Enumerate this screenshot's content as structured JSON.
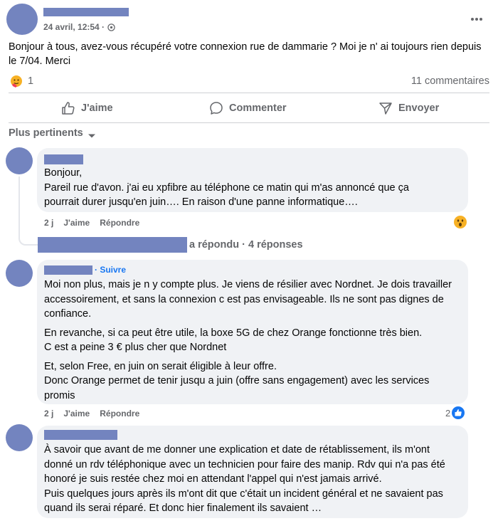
{
  "post": {
    "date": "24 avril, 12:54 ·",
    "text": "Bonjour à tous, avez-vous récupéré votre connexion rue de dammarie ? Moi je n' ai toujours rien depuis le 7/04. Merci",
    "reaction_count": "1",
    "comments_count": "11 commentaires",
    "options_icon": "more-horizontal-icon",
    "audience_icon": "globe-icon"
  },
  "actions": {
    "like": "J'aime",
    "comment": "Commenter",
    "send": "Envoyer"
  },
  "sort": {
    "label": "Plus pertinents"
  },
  "comments": [
    {
      "lines": [
        "Bonjour,",
        "Pareil rue d'avon. j'ai eu xpfibre au téléphone ce matin qui m'as annoncé que ça pourrait durer jusqu'en juin…. En raison d'une panne informatique…."
      ],
      "time": "2 j",
      "like": "J'aime",
      "reply": "Répondre",
      "reaction": "wow"
    },
    {
      "follow": "· Suivre",
      "paragraphs": [
        "Moi non plus, mais je n y compte plus. Je viens de résilier avec Nordnet. Je dois travailler accessoirement, et sans la connexion c est pas envisageable. Ils ne sont pas dignes de confiance.",
        "En revanche, si ca peut être utile, la boxe 5G de chez Orange fonctionne très bien.\nC est a peine 3 € plus cher que Nordnet",
        "Et, selon Free, en juin on serait éligible à leur offre.\nDonc Orange permet de tenir jusqu a juin (offre sans engagement) avec les services promis"
      ],
      "time": "2 j",
      "like": "J'aime",
      "reply": "Répondre",
      "reaction_count": "2"
    },
    {
      "text": "À savoir que avant de me donner une explication et date de rétablissement, ils m'ont donné un rdv téléphonique avec un technicien pour faire des manip. Rdv qui n'a pas été honoré je suis restée chez moi en attendant l'appel qui n'est jamais arrivé.\nPuis quelques jours après ils m'ont dit que c'était un incident général et ne savaient pas quand ils serai réparé. Et donc hier finalement ils savaient …"
    }
  ],
  "replies_summary": "a répondu · 4 réponses",
  "colors": {
    "accent": "#1877f2",
    "redaction": "#7384bf",
    "bubble": "#f0f2f5"
  }
}
